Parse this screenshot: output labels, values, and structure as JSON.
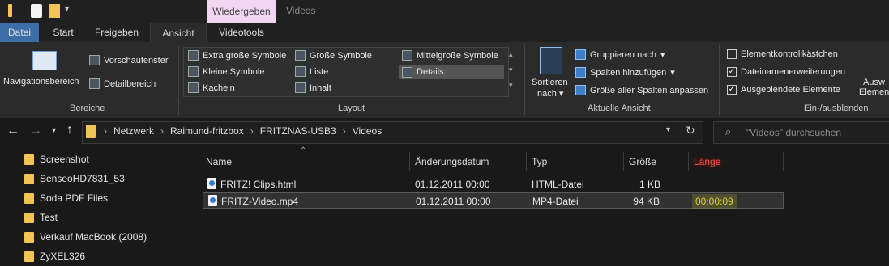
{
  "titlebar": {
    "context_tab": "Wiedergeben",
    "title": "Videos"
  },
  "tabs": [
    "Datei",
    "Start",
    "Freigeben",
    "Ansicht",
    "Videotools"
  ],
  "ribbon": {
    "panes": {
      "nav_label": "Navigationsbereich",
      "preview": "Vorschaufenster",
      "details": "Detailbereich",
      "group": "Bereiche"
    },
    "layout": {
      "items": [
        "Extra große Symbole",
        "Große Symbole",
        "Mittelgroße Symbole",
        "Kleine Symbole",
        "Liste",
        "Details",
        "Kacheln",
        "Inhalt"
      ],
      "group": "Layout"
    },
    "current_view": {
      "sort_label_1": "Sortieren",
      "sort_label_2": "nach",
      "group_by": "Gruppieren nach",
      "add_columns": "Spalten hinzufügen",
      "fit_columns": "Größe aller Spalten anpassen",
      "group": "Aktuelle Ansicht"
    },
    "show_hide": {
      "checkboxes": [
        {
          "label": "Elementkontrollkästchen",
          "checked": false
        },
        {
          "label": "Dateinamenerweiterungen",
          "checked": true
        },
        {
          "label": "Ausgeblendete Elemente",
          "checked": true
        }
      ],
      "group": "Ein-/ausblenden",
      "extra_1": "Ausw",
      "extra_2": "Elemen"
    }
  },
  "address": {
    "breadcrumb": [
      "Netzwerk",
      "Raimund-fritzbox",
      "FRITZNAS-USB3",
      "Videos"
    ],
    "search_placeholder": "\"Videos\" durchsuchen"
  },
  "tree": [
    "Screenshot",
    "SenseoHD7831_53",
    "Soda PDF Files",
    "Test",
    "Verkauf MacBook (2008)",
    "ZyXEL326"
  ],
  "columns": [
    "Name",
    "Änderungsdatum",
    "Typ",
    "Größe",
    "Länge"
  ],
  "files": [
    {
      "name": "FRITZ! Clips.html",
      "date": "01.12.2011 00:00",
      "type": "HTML-Datei",
      "size": "1 KB",
      "length": ""
    },
    {
      "name": "FRITZ-Video.mp4",
      "date": "01.12.2011 00:00",
      "type": "MP4-Datei",
      "size": "94 KB",
      "length": "00:00:09"
    }
  ],
  "colors": {
    "folder": "#f0c455",
    "context_tab": "#f2d5f0",
    "length_highlight": "#d6d23a",
    "length_header": "#ff3b3b"
  }
}
